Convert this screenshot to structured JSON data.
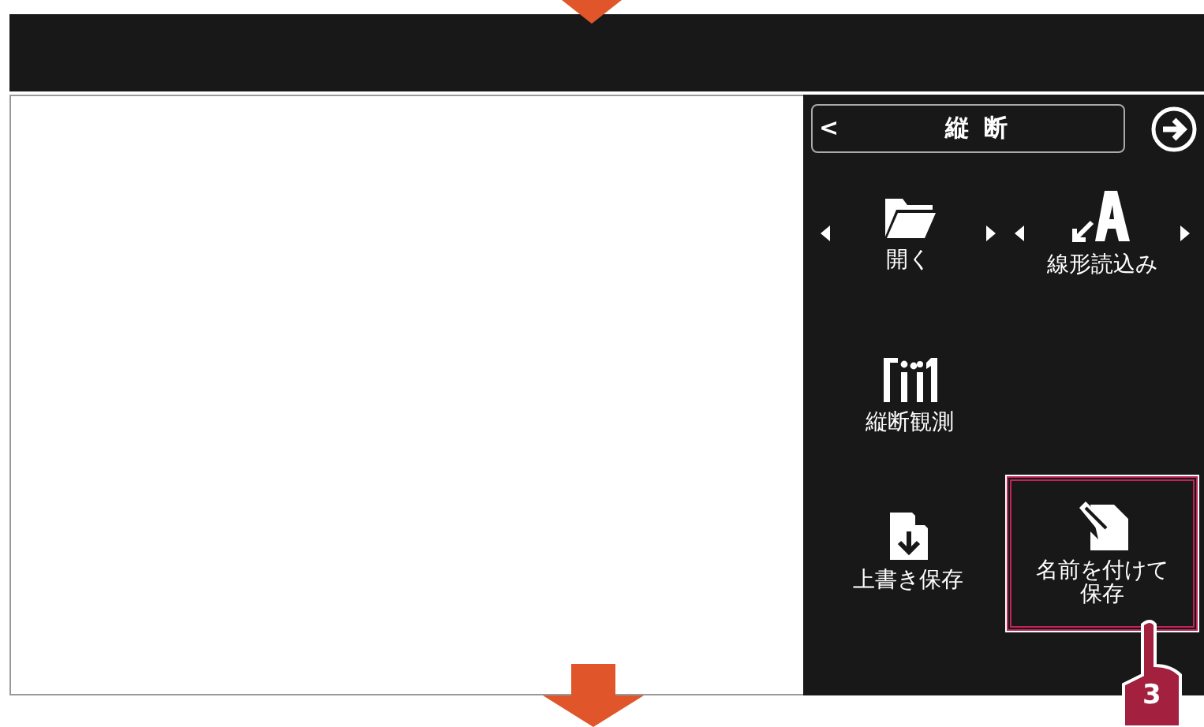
{
  "panel": {
    "back": "<",
    "title": "縦 断"
  },
  "rows": [
    [
      {
        "label": "開く",
        "kind": "folder",
        "arrows": true,
        "selected": false
      },
      {
        "label": "線形読込み",
        "kind": "road",
        "arrows": true,
        "selected": false
      }
    ],
    [
      {
        "label": "縦断観測",
        "kind": "poles",
        "arrows": false,
        "selected": false
      }
    ],
    [
      {
        "label": "上書き保存",
        "kind": "save",
        "arrows": false,
        "selected": false
      },
      {
        "label": "名前を付けて保存",
        "kind": "saveas",
        "arrows": false,
        "selected": true
      }
    ]
  ],
  "callout": {
    "step": "3"
  }
}
